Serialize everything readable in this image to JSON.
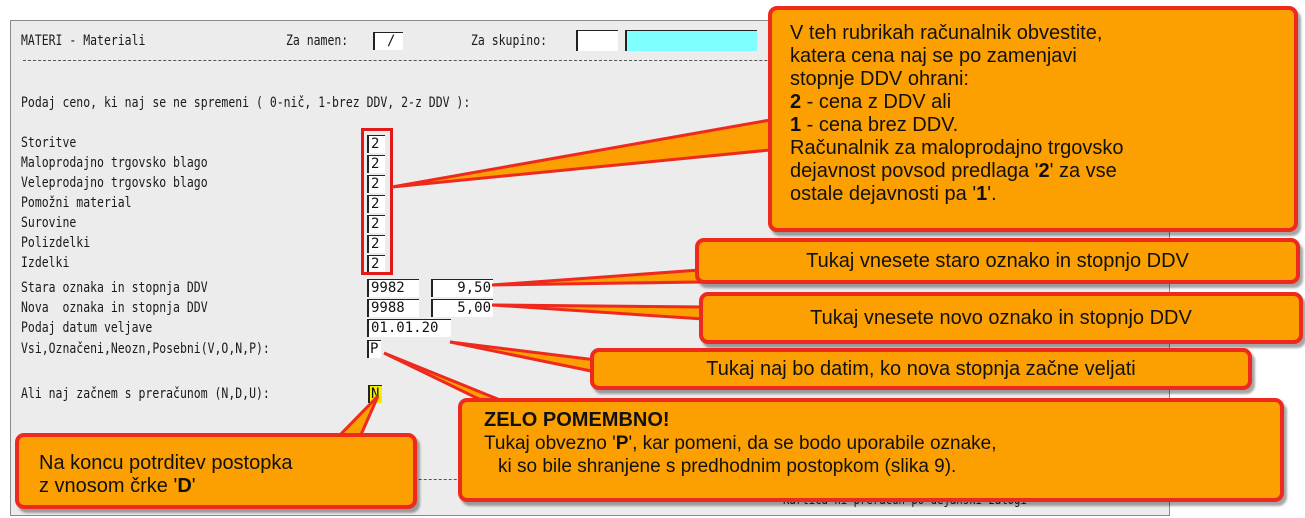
{
  "window": {
    "title": "MATERI - Materiali",
    "za_namen_label": "Za namen:",
    "za_namen_value": "/",
    "za_skupino_label": "Za skupino:",
    "za_skupino_value": ""
  },
  "prompt": "Podaj ceno, ki naj se ne spremeni ( 0-nič, 1-brez DDV, 2-z DDV ):",
  "price_rows": [
    {
      "label": "Storitve",
      "value": "2"
    },
    {
      "label": "Maloprodajno trgovsko blago",
      "value": "2"
    },
    {
      "label": "Veleprodajno trgovsko blago",
      "value": "2"
    },
    {
      "label": "Pomožni material",
      "value": "2"
    },
    {
      "label": "Surovine",
      "value": "2"
    },
    {
      "label": "Polizdelki",
      "value": "2"
    },
    {
      "label": "Izdelki",
      "value": "2"
    }
  ],
  "vat": {
    "old_label": "Stara oznaka in stopnja DDV",
    "old_code": "9982",
    "old_rate": "9,50",
    "new_label": "Nova  oznaka in stopnja DDV",
    "new_code": "9988",
    "new_rate": "5,00",
    "date_label": "Podaj datum veljave",
    "date_value": "01.01.20",
    "selection_label": "Vsi,Označeni,Neozn,Posebni(V,O,N,P):",
    "selection_value": "P"
  },
  "confirm": {
    "label": "Ali naj začnem s preračunom (N,D,U):",
    "value": "N"
  },
  "status_bar": "Kartica ni preračun po dejanski zalogi",
  "callouts": {
    "price_info": {
      "line1": "V teh rubrikah računalnik obvestite,",
      "line2": "katera cena naj se po zamenjavi",
      "line3": "stopnje DDV ohrani:",
      "opt2_key": "2",
      "opt2_text": " - cena z DDV ali",
      "opt1_key": "1",
      "opt1_text": " - cena brez DDV.",
      "line6": "Računalnik za maloprodajno trgovsko",
      "line7a": "dejavnost povsod predlaga '",
      "line7b": "2",
      "line7c": "' za vse",
      "line8a": "ostale dejavnosti pa '",
      "line8b": "1",
      "line8c": "'."
    },
    "old_vat": "Tukaj vnesete staro oznako in stopnjo DDV",
    "new_vat": "Tukaj vnesete novo oznako in stopnjo DDV",
    "date": "Tukaj naj bo datim, ko nova stopnja začne veljati",
    "important_title": "ZELO POMEMBNO!",
    "important_a": "Tukaj obvezno '",
    "important_b": "P",
    "important_c": "', kar pomeni, da se bodo uporabile oznake,",
    "important_line2": "ki so bile shranjene s predhodnim postopkom (slika 9).",
    "final_line1": "Na koncu potrditev postopka",
    "final_line2a": "z vnosom črke '",
    "final_line2b": "D",
    "final_line2c": "'"
  },
  "colors": {
    "callout_fill": "#fc9f00",
    "callout_border": "#ee2a1f",
    "highlight_field": "#80ffff",
    "confirm_field": "#f5f000"
  }
}
